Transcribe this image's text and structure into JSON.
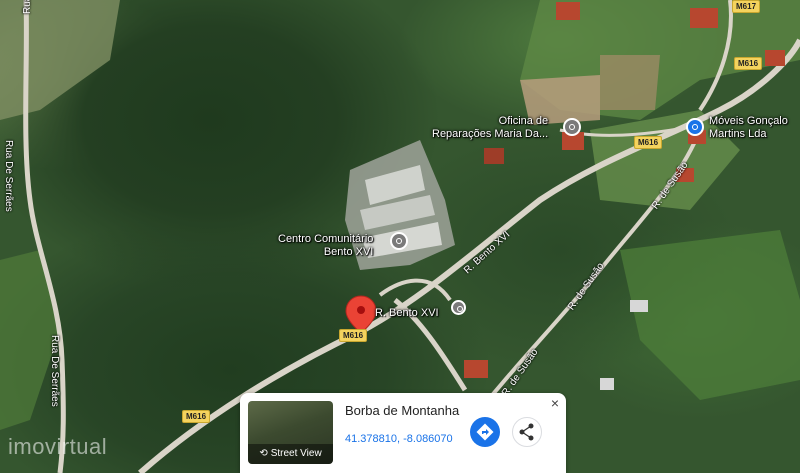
{
  "map": {
    "pois": {
      "oficina": "Oficina de\nReparações Maria Da...",
      "moveis": "Móveis Gonçalo\nMartins Lda",
      "centro": "Centro Comunitário\nBento XVI",
      "pin_label": "R. Bento XVI"
    },
    "roads": {
      "rua_serraes_1": "Rua De Serrães",
      "rua_serraes_2": "Rua De Serrães",
      "bento_xvi": "R. Bento XVI",
      "susao_1": "R. de Susão",
      "susao_2": "R. de Susão",
      "susao_3": "R. de Susão",
      "rua_top": "Rua"
    },
    "shields": {
      "m616_a": "M616",
      "m616_b": "M616",
      "m616_c": "M616",
      "m616_d": "M616",
      "m617": "M617"
    },
    "watermark": "imovirtual",
    "colors": {
      "pin": "#ea4335",
      "action": "#1a73e8",
      "shield": "#f4d35e"
    }
  },
  "card": {
    "title": "Borba de Montanha",
    "coords": "41.378810, -8.086070",
    "street_view": "Street View",
    "close": "×"
  }
}
